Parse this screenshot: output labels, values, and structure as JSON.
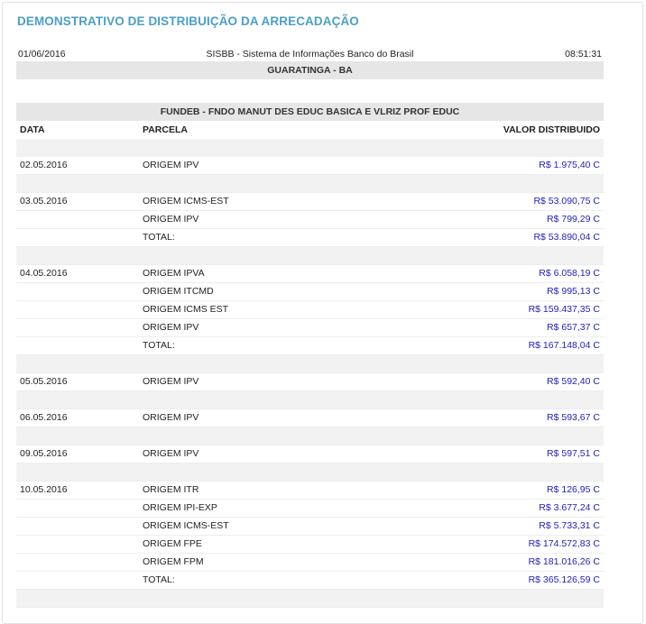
{
  "page_title": "DEMONSTRATIVO DE DISTRIBUIÇÃO DA ARRECADAÇÃO",
  "header": {
    "date": "01/06/2016",
    "system": "SISBB - Sistema de Informações Banco do Brasil",
    "time": "08:51:31",
    "location": "GUARATINGA - BA"
  },
  "fund_title": "FUNDEB - FNDO MANUT DES EDUC BASICA E VLRIZ PROF EDUC",
  "columns": {
    "data": "DATA",
    "parcela": "PARCELA",
    "valor": "VALOR DISTRIBUIDO"
  },
  "rows": [
    {
      "type": "blank"
    },
    {
      "type": "data",
      "date": "02.05.2016",
      "parcela": "ORIGEM IPV",
      "valor": "R$ 1.975,40 C"
    },
    {
      "type": "blank"
    },
    {
      "type": "data",
      "date": "03.05.2016",
      "parcela": "ORIGEM ICMS-EST",
      "valor": "R$ 53.090,75 C"
    },
    {
      "type": "data",
      "date": "",
      "parcela": "ORIGEM IPV",
      "valor": "R$ 799,29 C"
    },
    {
      "type": "data",
      "date": "",
      "parcela": "TOTAL:",
      "valor": "R$ 53.890,04 C"
    },
    {
      "type": "blank"
    },
    {
      "type": "data",
      "date": "04.05.2016",
      "parcela": "ORIGEM IPVA",
      "valor": "R$ 6.058,19 C"
    },
    {
      "type": "data",
      "date": "",
      "parcela": "ORIGEM ITCMD",
      "valor": "R$ 995,13 C"
    },
    {
      "type": "data",
      "date": "",
      "parcela": "ORIGEM ICMS EST",
      "valor": "R$ 159.437,35 C"
    },
    {
      "type": "data",
      "date": "",
      "parcela": "ORIGEM IPV",
      "valor": "R$ 657,37 C"
    },
    {
      "type": "data",
      "date": "",
      "parcela": "TOTAL:",
      "valor": "R$ 167.148,04 C"
    },
    {
      "type": "blank"
    },
    {
      "type": "data",
      "date": "05.05.2016",
      "parcela": "ORIGEM IPV",
      "valor": "R$ 592,40 C"
    },
    {
      "type": "blank"
    },
    {
      "type": "data",
      "date": "06.05.2016",
      "parcela": "ORIGEM IPV",
      "valor": "R$ 593,67 C"
    },
    {
      "type": "blank"
    },
    {
      "type": "data",
      "date": "09.05.2016",
      "parcela": "ORIGEM IPV",
      "valor": "R$ 597,51 C"
    },
    {
      "type": "blank"
    },
    {
      "type": "data",
      "date": "10.05.2016",
      "parcela": "ORIGEM ITR",
      "valor": "R$ 126,95 C"
    },
    {
      "type": "data",
      "date": "",
      "parcela": "ORIGEM IPI-EXP",
      "valor": "R$ 3.677,24 C"
    },
    {
      "type": "data",
      "date": "",
      "parcela": "ORIGEM ICMS-EST",
      "valor": "R$ 5.733,31 C"
    },
    {
      "type": "data",
      "date": "",
      "parcela": "ORIGEM FPE",
      "valor": "R$ 174.572,83 C"
    },
    {
      "type": "data",
      "date": "",
      "parcela": "ORIGEM FPM",
      "valor": "R$ 181.016,26 C"
    },
    {
      "type": "data",
      "date": "",
      "parcela": "TOTAL:",
      "valor": "R$ 365.126,59 C"
    },
    {
      "type": "blank"
    }
  ]
}
